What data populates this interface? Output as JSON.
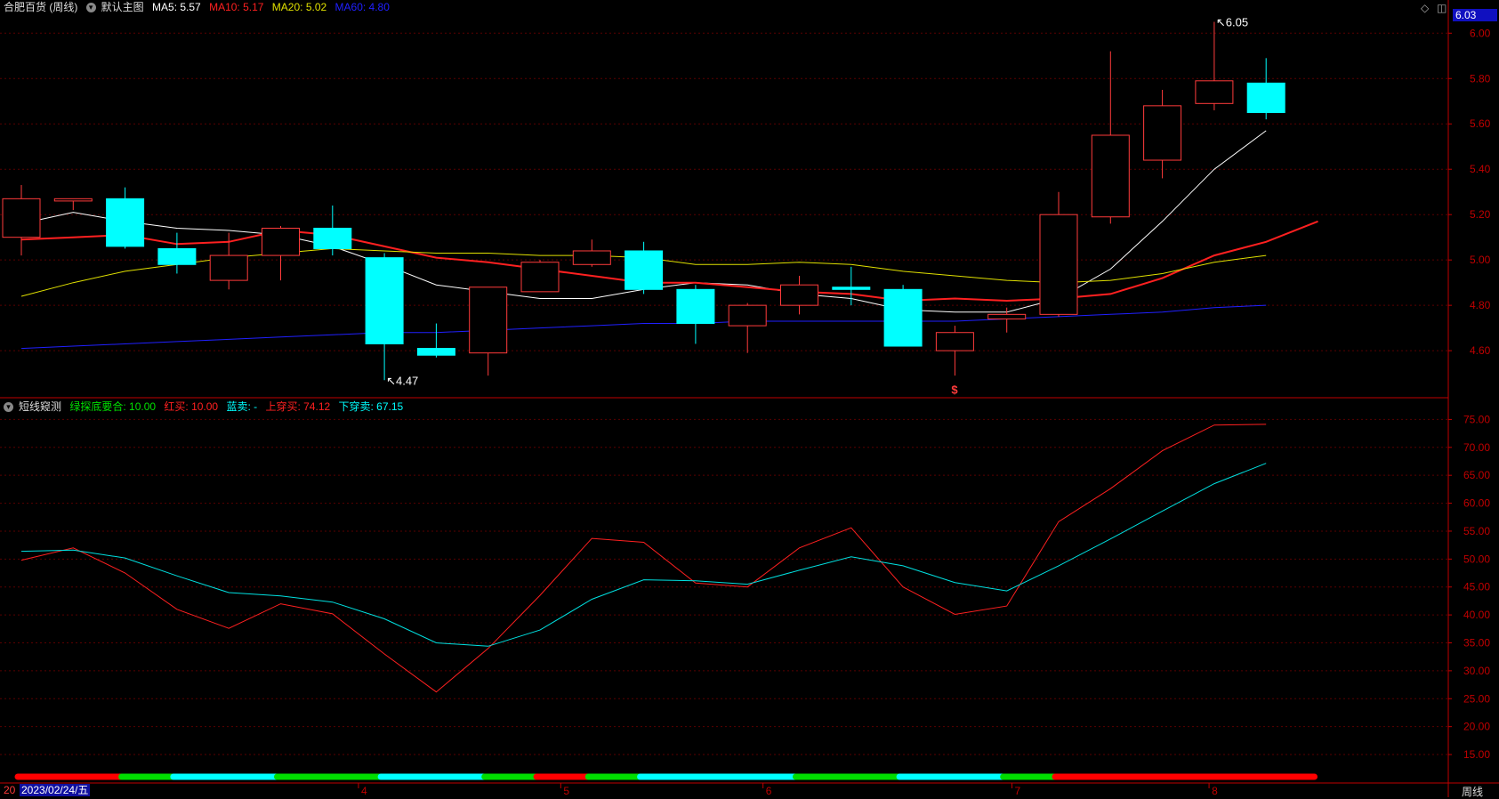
{
  "main_header": {
    "title": "合肥百货 (周线)",
    "template": "默认主图",
    "ma5": "MA5: 5.57",
    "ma10": "MA10: 5.17",
    "ma20": "MA20: 5.02",
    "ma60": "MA60: 4.80"
  },
  "sub_header": {
    "title": "短线窥测",
    "green": "绿探底要合: 10.00",
    "red": "红买: 10.00",
    "blue": "蓝卖: -",
    "up": "上穿买: 74.12",
    "down": "下穿卖: 67.15"
  },
  "current_price_tag": "6.03",
  "bottom_bar": {
    "left_stub": "20",
    "date": "2023/02/24/五",
    "period": "周线"
  },
  "colors": {
    "up": "#ff3b3b",
    "down": "#00ffff",
    "ma5": "#ffffff",
    "ma10": "#ff2020",
    "ma20": "#e0e000",
    "ma60": "#2020ff",
    "grid": "#5a0000",
    "axis": "#c00000"
  },
  "chart_data": [
    {
      "type": "candlestick",
      "title": "合肥百货 (周线)",
      "ylim": [
        4.42,
        6.06
      ],
      "y_ticks": [
        "6.00",
        "5.80",
        "5.60",
        "5.40",
        "5.20",
        "5.00",
        "4.80",
        "4.60"
      ],
      "x_tick_labels": [
        {
          "label": "4",
          "index": 6.5
        },
        {
          "label": "5",
          "index": 10.4
        },
        {
          "label": "6",
          "index": 14.3
        },
        {
          "label": "7",
          "index": 19.1
        },
        {
          "label": "8",
          "index": 22.9
        }
      ],
      "candles": [
        {
          "o": 5.1,
          "h": 5.33,
          "l": 5.02,
          "c": 5.27
        },
        {
          "o": 5.26,
          "h": 5.27,
          "l": 5.22,
          "c": 5.27
        },
        {
          "o": 5.27,
          "h": 5.32,
          "l": 5.05,
          "c": 5.06
        },
        {
          "o": 5.05,
          "h": 5.12,
          "l": 4.94,
          "c": 4.98
        },
        {
          "o": 4.91,
          "h": 5.12,
          "l": 4.87,
          "c": 5.02
        },
        {
          "o": 5.02,
          "h": 5.15,
          "l": 4.91,
          "c": 5.14
        },
        {
          "o": 5.14,
          "h": 5.24,
          "l": 5.02,
          "c": 5.05
        },
        {
          "o": 5.01,
          "h": 5.03,
          "l": 4.47,
          "c": 4.63
        },
        {
          "o": 4.61,
          "h": 4.72,
          "l": 4.57,
          "c": 4.58
        },
        {
          "o": 4.59,
          "h": 4.88,
          "l": 4.49,
          "c": 4.88
        },
        {
          "o": 4.86,
          "h": 5.0,
          "l": 4.86,
          "c": 4.99
        },
        {
          "o": 4.98,
          "h": 5.09,
          "l": 4.97,
          "c": 5.04
        },
        {
          "o": 5.04,
          "h": 5.08,
          "l": 4.85,
          "c": 4.87
        },
        {
          "o": 4.87,
          "h": 4.89,
          "l": 4.63,
          "c": 4.72
        },
        {
          "o": 4.71,
          "h": 4.81,
          "l": 4.59,
          "c": 4.8
        },
        {
          "o": 4.8,
          "h": 4.93,
          "l": 4.76,
          "c": 4.89
        },
        {
          "o": 4.88,
          "h": 4.97,
          "l": 4.8,
          "c": 4.87
        },
        {
          "o": 4.87,
          "h": 4.89,
          "l": 4.62,
          "c": 4.62
        },
        {
          "o": 4.6,
          "h": 4.71,
          "l": 4.49,
          "c": 4.68
        },
        {
          "o": 4.74,
          "h": 4.79,
          "l": 4.68,
          "c": 4.76
        },
        {
          "o": 4.76,
          "h": 5.3,
          "l": 4.75,
          "c": 5.2
        },
        {
          "o": 5.19,
          "h": 5.92,
          "l": 5.16,
          "c": 5.55
        },
        {
          "o": 5.44,
          "h": 5.75,
          "l": 5.36,
          "c": 5.68
        },
        {
          "o": 5.69,
          "h": 6.05,
          "l": 5.66,
          "c": 5.79
        },
        {
          "o": 5.78,
          "h": 5.89,
          "l": 5.62,
          "c": 5.65
        }
      ],
      "series": [
        {
          "name": "MA5",
          "values": [
            5.16,
            5.21,
            5.17,
            5.14,
            5.13,
            5.11,
            5.06,
            4.98,
            4.89,
            4.86,
            4.83,
            4.83,
            4.87,
            4.9,
            4.89,
            4.85,
            4.83,
            4.78,
            4.77,
            4.77,
            4.83,
            4.96,
            5.17,
            5.4,
            5.57
          ]
        },
        {
          "name": "MA10",
          "values": [
            5.09,
            5.1,
            5.11,
            5.07,
            5.08,
            5.13,
            5.11,
            5.06,
            5.01,
            4.99,
            4.96,
            4.93,
            4.9,
            4.9,
            4.88,
            4.86,
            4.85,
            4.82,
            4.83,
            4.82,
            4.83,
            4.85,
            4.92,
            5.02,
            5.08,
            5.17
          ]
        },
        {
          "name": "MA20",
          "values": [
            4.84,
            4.9,
            4.95,
            4.98,
            5.01,
            5.03,
            5.05,
            5.04,
            5.03,
            5.03,
            5.02,
            5.02,
            5.01,
            4.98,
            4.98,
            4.99,
            4.98,
            4.95,
            4.93,
            4.91,
            4.9,
            4.91,
            4.94,
            4.99,
            5.02
          ]
        },
        {
          "name": "MA60",
          "values": [
            4.61,
            4.62,
            4.63,
            4.64,
            4.65,
            4.66,
            4.67,
            4.68,
            4.68,
            4.69,
            4.7,
            4.71,
            4.72,
            4.72,
            4.73,
            4.73,
            4.73,
            4.73,
            4.73,
            4.74,
            4.75,
            4.76,
            4.77,
            4.79,
            4.8
          ]
        }
      ],
      "annotations": [
        {
          "label": "6.05",
          "index": 23,
          "value": 6.05
        },
        {
          "label": "4.47",
          "index": 7,
          "value": 4.47
        },
        {
          "label": "$",
          "index": 18,
          "value": 4.45
        }
      ]
    },
    {
      "type": "line",
      "title": "短线窥测",
      "ylim": [
        11.5,
        76.5
      ],
      "y_ticks": [
        "75.00",
        "70.00",
        "65.00",
        "60.00",
        "55.00",
        "50.00",
        "45.00",
        "40.00",
        "35.00",
        "30.00",
        "25.00",
        "20.00",
        "15.00"
      ],
      "series": [
        {
          "name": "上穿买",
          "values": [
            49.8,
            52.0,
            47.5,
            41.0,
            37.6,
            42.0,
            40.2,
            33.0,
            26.2,
            34.0,
            43.5,
            53.7,
            53.0,
            45.7,
            45.0,
            52.0,
            55.6,
            45.0,
            40.1,
            41.6,
            56.7,
            62.6,
            69.4,
            74.0,
            74.12
          ]
        },
        {
          "name": "下穿卖",
          "values": [
            51.4,
            51.6,
            50.2,
            47.0,
            44.0,
            43.4,
            42.3,
            39.3,
            35.0,
            34.4,
            37.3,
            42.8,
            46.3,
            46.1,
            45.5,
            48.0,
            50.4,
            48.8,
            45.8,
            44.3,
            48.8,
            53.6,
            58.6,
            63.5,
            67.15
          ]
        }
      ],
      "signal_bar": [
        {
          "color": "red",
          "from": 0,
          "to": 2
        },
        {
          "color": "green",
          "from": 2,
          "to": 3
        },
        {
          "color": "cyan",
          "from": 3,
          "to": 5
        },
        {
          "color": "green",
          "from": 5,
          "to": 7
        },
        {
          "color": "cyan",
          "from": 7,
          "to": 9
        },
        {
          "color": "green",
          "from": 9,
          "to": 10
        },
        {
          "color": "red",
          "from": 10,
          "to": 11
        },
        {
          "color": "green",
          "from": 11,
          "to": 12
        },
        {
          "color": "cyan",
          "from": 12,
          "to": 15
        },
        {
          "color": "green",
          "from": 15,
          "to": 17
        },
        {
          "color": "cyan",
          "from": 17,
          "to": 19
        },
        {
          "color": "green",
          "from": 19,
          "to": 20
        },
        {
          "color": "red",
          "from": 20,
          "to": 25
        }
      ]
    }
  ]
}
